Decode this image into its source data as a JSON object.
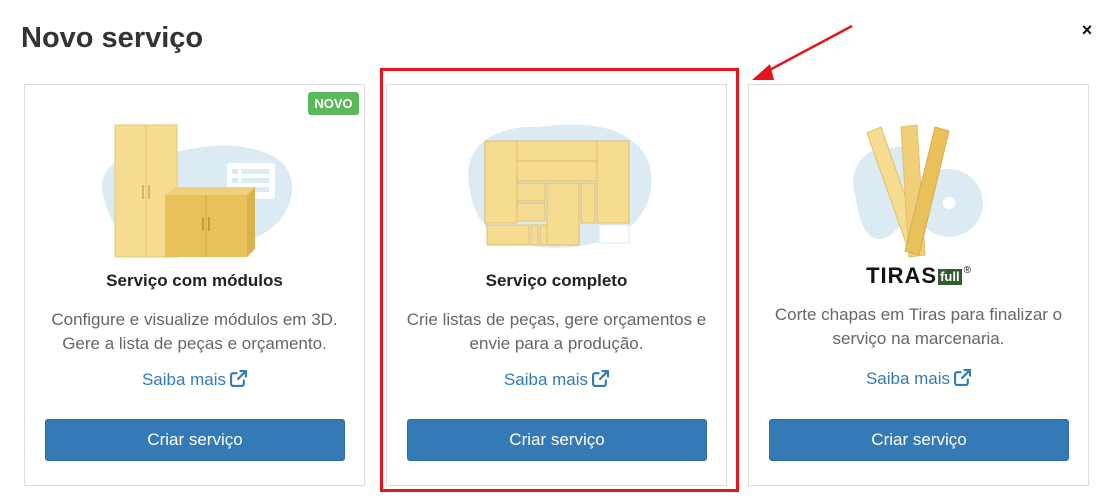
{
  "modal": {
    "title": "Novo serviço",
    "close_label": "×"
  },
  "cards": [
    {
      "badge": "NOVO",
      "title": "Serviço com módulos",
      "description": "Configure e visualize módulos em 3D. Gere a lista de peças e orçamento.",
      "link": "Saiba mais",
      "button": "Criar serviço"
    },
    {
      "title": "Serviço completo",
      "description": "Crie listas de peças, gere orçamentos e envie para a produção.",
      "link": "Saiba mais",
      "button": "Criar serviço",
      "highlighted": true
    },
    {
      "logo_text": "TIRAS",
      "logo_suffix": "full",
      "logo_mark": "®",
      "description": "Corte chapas em Tiras para finalizar o serviço na marcenaria.",
      "link": "Saiba mais",
      "button": "Criar serviço"
    }
  ],
  "colors": {
    "primary": "#337ab7",
    "badge": "#5cb85c",
    "highlight": "#e8141c",
    "wood_light": "#f5dc91",
    "wood_dark": "#e8c15a",
    "blob": "#dcebf3"
  },
  "icons": [
    "close-icon",
    "external-link-icon",
    "cabinet-illustration",
    "cut-list-illustration",
    "saw-illustration",
    "arrow-annotation"
  ]
}
